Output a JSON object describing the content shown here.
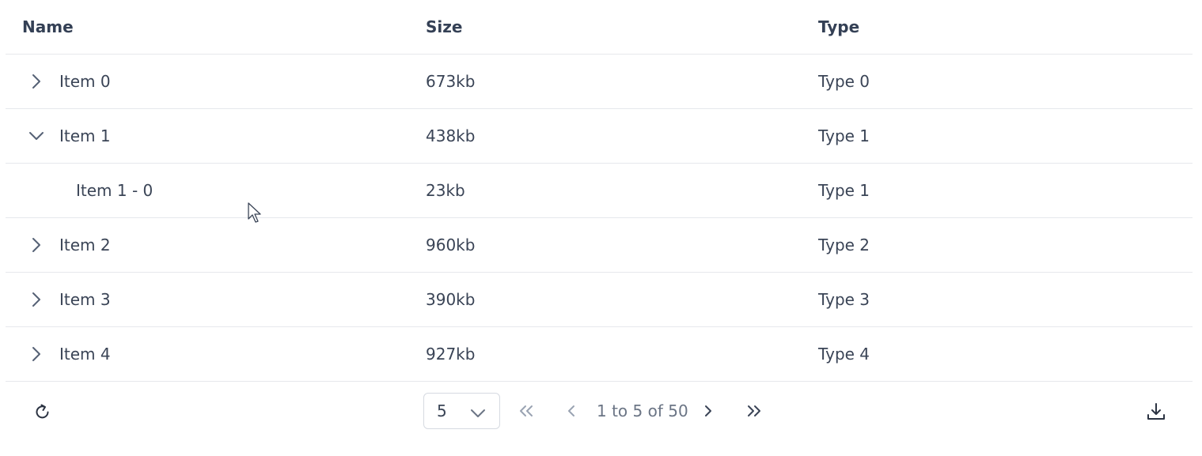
{
  "columns": {
    "name": "Name",
    "size": "Size",
    "type": "Type"
  },
  "rows": [
    {
      "name": "Item 0",
      "size": "673kb",
      "type": "Type 0",
      "expander": "chevron-right-icon"
    },
    {
      "name": "Item 1",
      "size": "438kb",
      "type": "Type 1",
      "expander": "chevron-down-icon"
    },
    {
      "name": "Item 1 - 0",
      "size": "23kb",
      "type": "Type 1"
    },
    {
      "name": "Item 2",
      "size": "960kb",
      "type": "Type 2",
      "expander": "chevron-right-icon"
    },
    {
      "name": "Item 3",
      "size": "390kb",
      "type": "Type 3",
      "expander": "chevron-right-icon"
    },
    {
      "name": "Item 4",
      "size": "927kb",
      "type": "Type 4",
      "expander": "chevron-right-icon"
    }
  ],
  "footer": {
    "page_size": "5",
    "status": "1 to 5 of 50",
    "icons": [
      "refresh-icon",
      "chevron-down-icon",
      "first-page-icon",
      "previous-page-icon",
      "next-page-icon",
      "last-page-icon",
      "download-icon"
    ]
  },
  "colors": {
    "text": "#3a4456",
    "muted": "#6b7585",
    "border": "#e6e8ec"
  }
}
